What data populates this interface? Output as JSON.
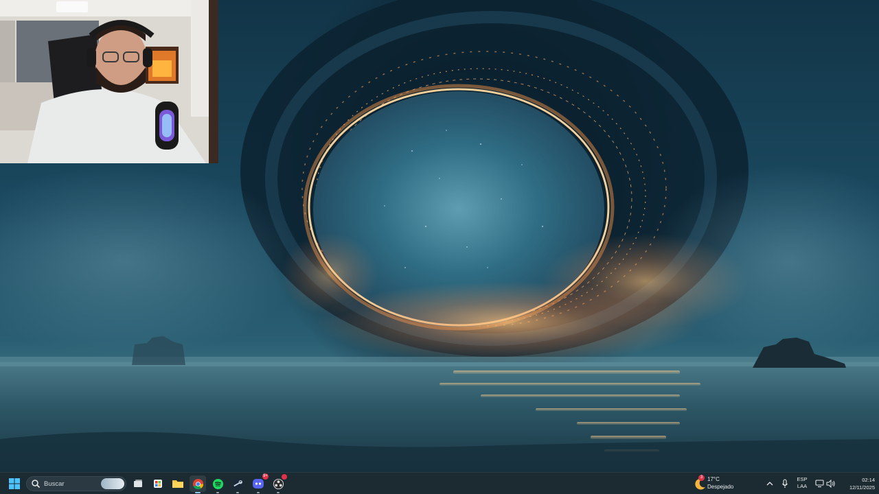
{
  "desktop": {
    "wallpaper": "portal-over-ocean",
    "webcam_overlay": "streamer-webcam"
  },
  "taskbar": {
    "start_icon": "windows-start-icon",
    "search": {
      "placeholder": "Buscar",
      "icon": "search-icon"
    },
    "apps": [
      {
        "name": "task-view-icon",
        "state": "idle"
      },
      {
        "name": "store-app-icon",
        "state": "idle"
      },
      {
        "name": "file-explorer-icon",
        "state": "idle"
      },
      {
        "name": "chrome-icon",
        "state": "active"
      },
      {
        "name": "spotify-icon",
        "state": "running"
      },
      {
        "name": "steam-icon",
        "state": "running"
      },
      {
        "name": "discord-icon",
        "state": "running",
        "badge": "9+"
      },
      {
        "name": "obs-icon",
        "state": "running",
        "badge": ""
      }
    ],
    "weather": {
      "temperature": "17°C",
      "condition": "Despejado",
      "badge": "3"
    },
    "tray": {
      "chevron_icon": "chevron-up-icon",
      "mic_icon": "microphone-icon",
      "language_line1": "ESP",
      "language_line2": "LAA",
      "network_icon": "network-icon",
      "volume_icon": "volume-icon"
    },
    "clock": {
      "time": "02:14",
      "date": "12/11/2025"
    }
  },
  "colors": {
    "taskbar_bg": "#1c2a31",
    "portal_glow": "#ffb061",
    "accent": "#8ec6e8"
  }
}
